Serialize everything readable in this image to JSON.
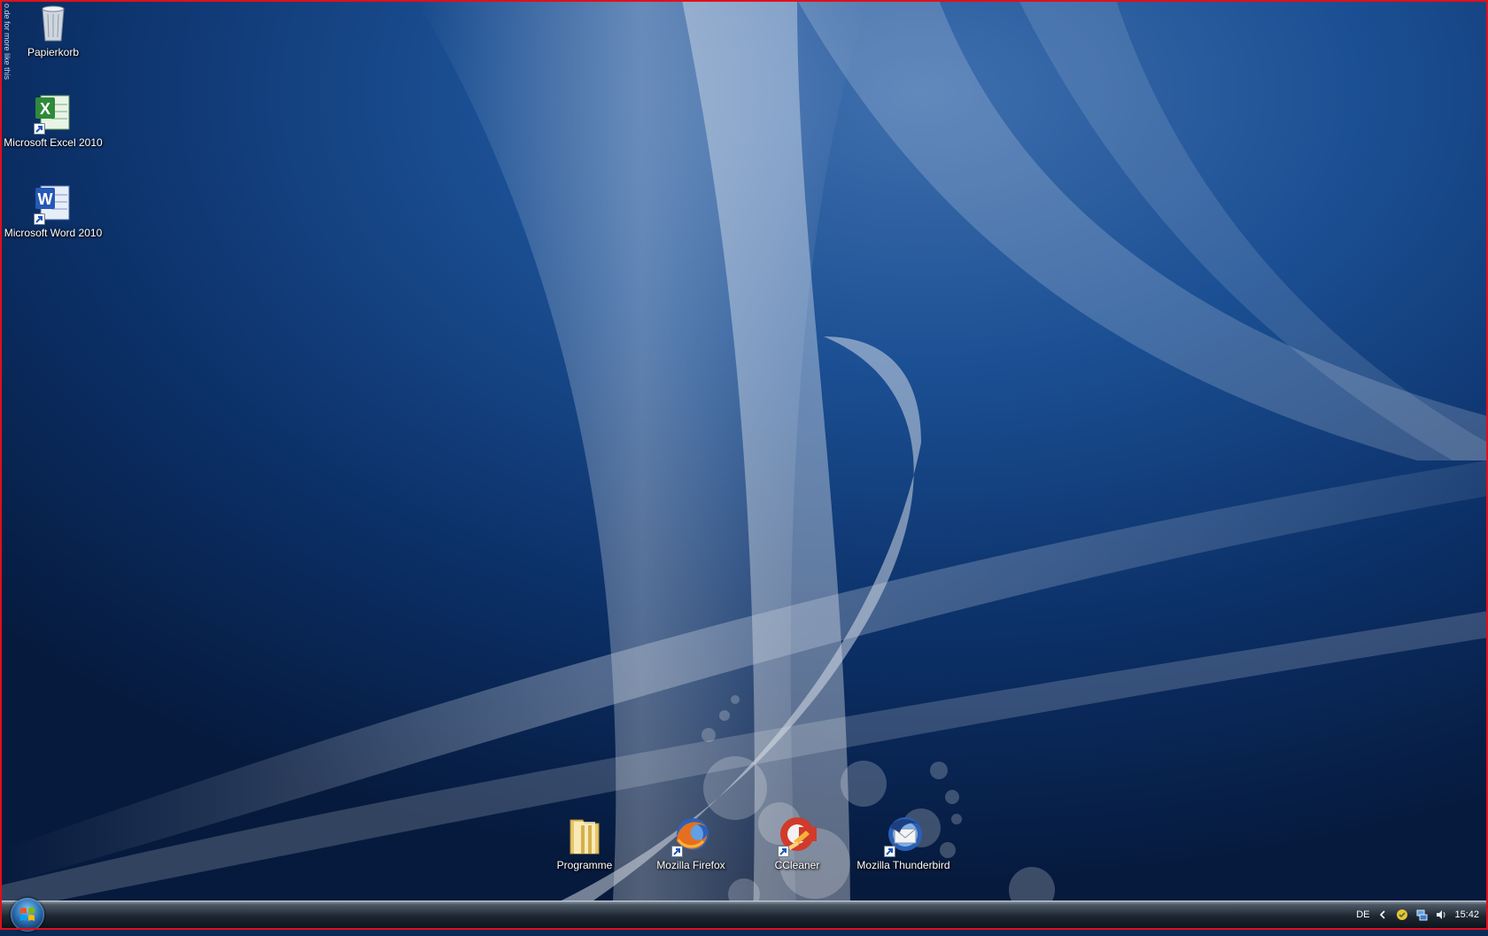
{
  "desktop": {
    "wallpaper_credit": "o.de for more like this",
    "left_icons": [
      {
        "label": "Papierkorb",
        "icon": "recycle-bin-icon"
      },
      {
        "label": "Microsoft Excel 2010",
        "icon": "excel-icon"
      },
      {
        "label": "Microsoft Word 2010",
        "icon": "word-icon"
      }
    ],
    "bottom_icons": [
      {
        "label": "Programme",
        "icon": "folder-icon"
      },
      {
        "label": "Mozilla Firefox",
        "icon": "firefox-icon"
      },
      {
        "label": "CCleaner",
        "icon": "ccleaner-icon"
      },
      {
        "label": "Mozilla Thunderbird",
        "icon": "thunderbird-icon"
      }
    ]
  },
  "taskbar": {
    "start_icon": "windows-start-orb-icon",
    "language": "DE",
    "tray_icons": [
      "chevron-left-icon",
      "security-shield-icon",
      "network-icon",
      "volume-icon"
    ],
    "clock": "15:42"
  },
  "colors": {
    "frame_border": "#e0101a",
    "wallpaper_base": "#0b2a5a"
  }
}
